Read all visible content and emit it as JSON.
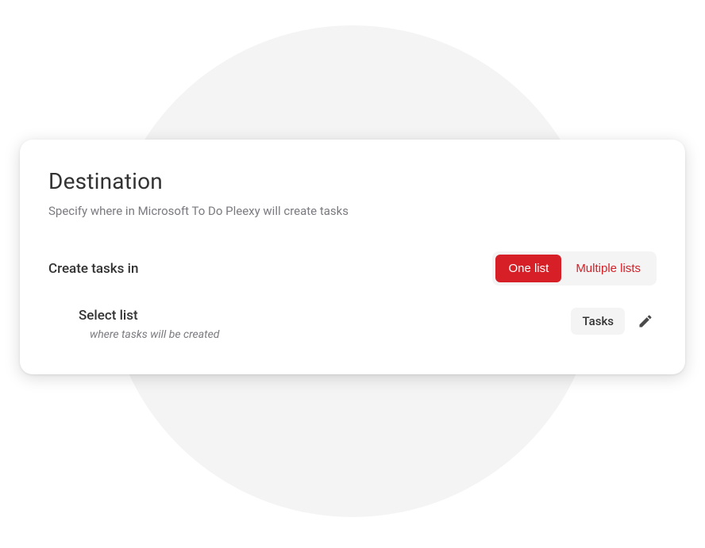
{
  "card": {
    "title": "Destination",
    "subtitle": "Specify where in Microsoft To Do Pleexy will create tasks"
  },
  "create_tasks": {
    "label": "Create tasks in",
    "options": {
      "one_list": "One list",
      "multiple_lists": "Multiple lists"
    },
    "selected": "one_list"
  },
  "select_list": {
    "label": "Select list",
    "hint": "where tasks will be created",
    "value": "Tasks"
  }
}
